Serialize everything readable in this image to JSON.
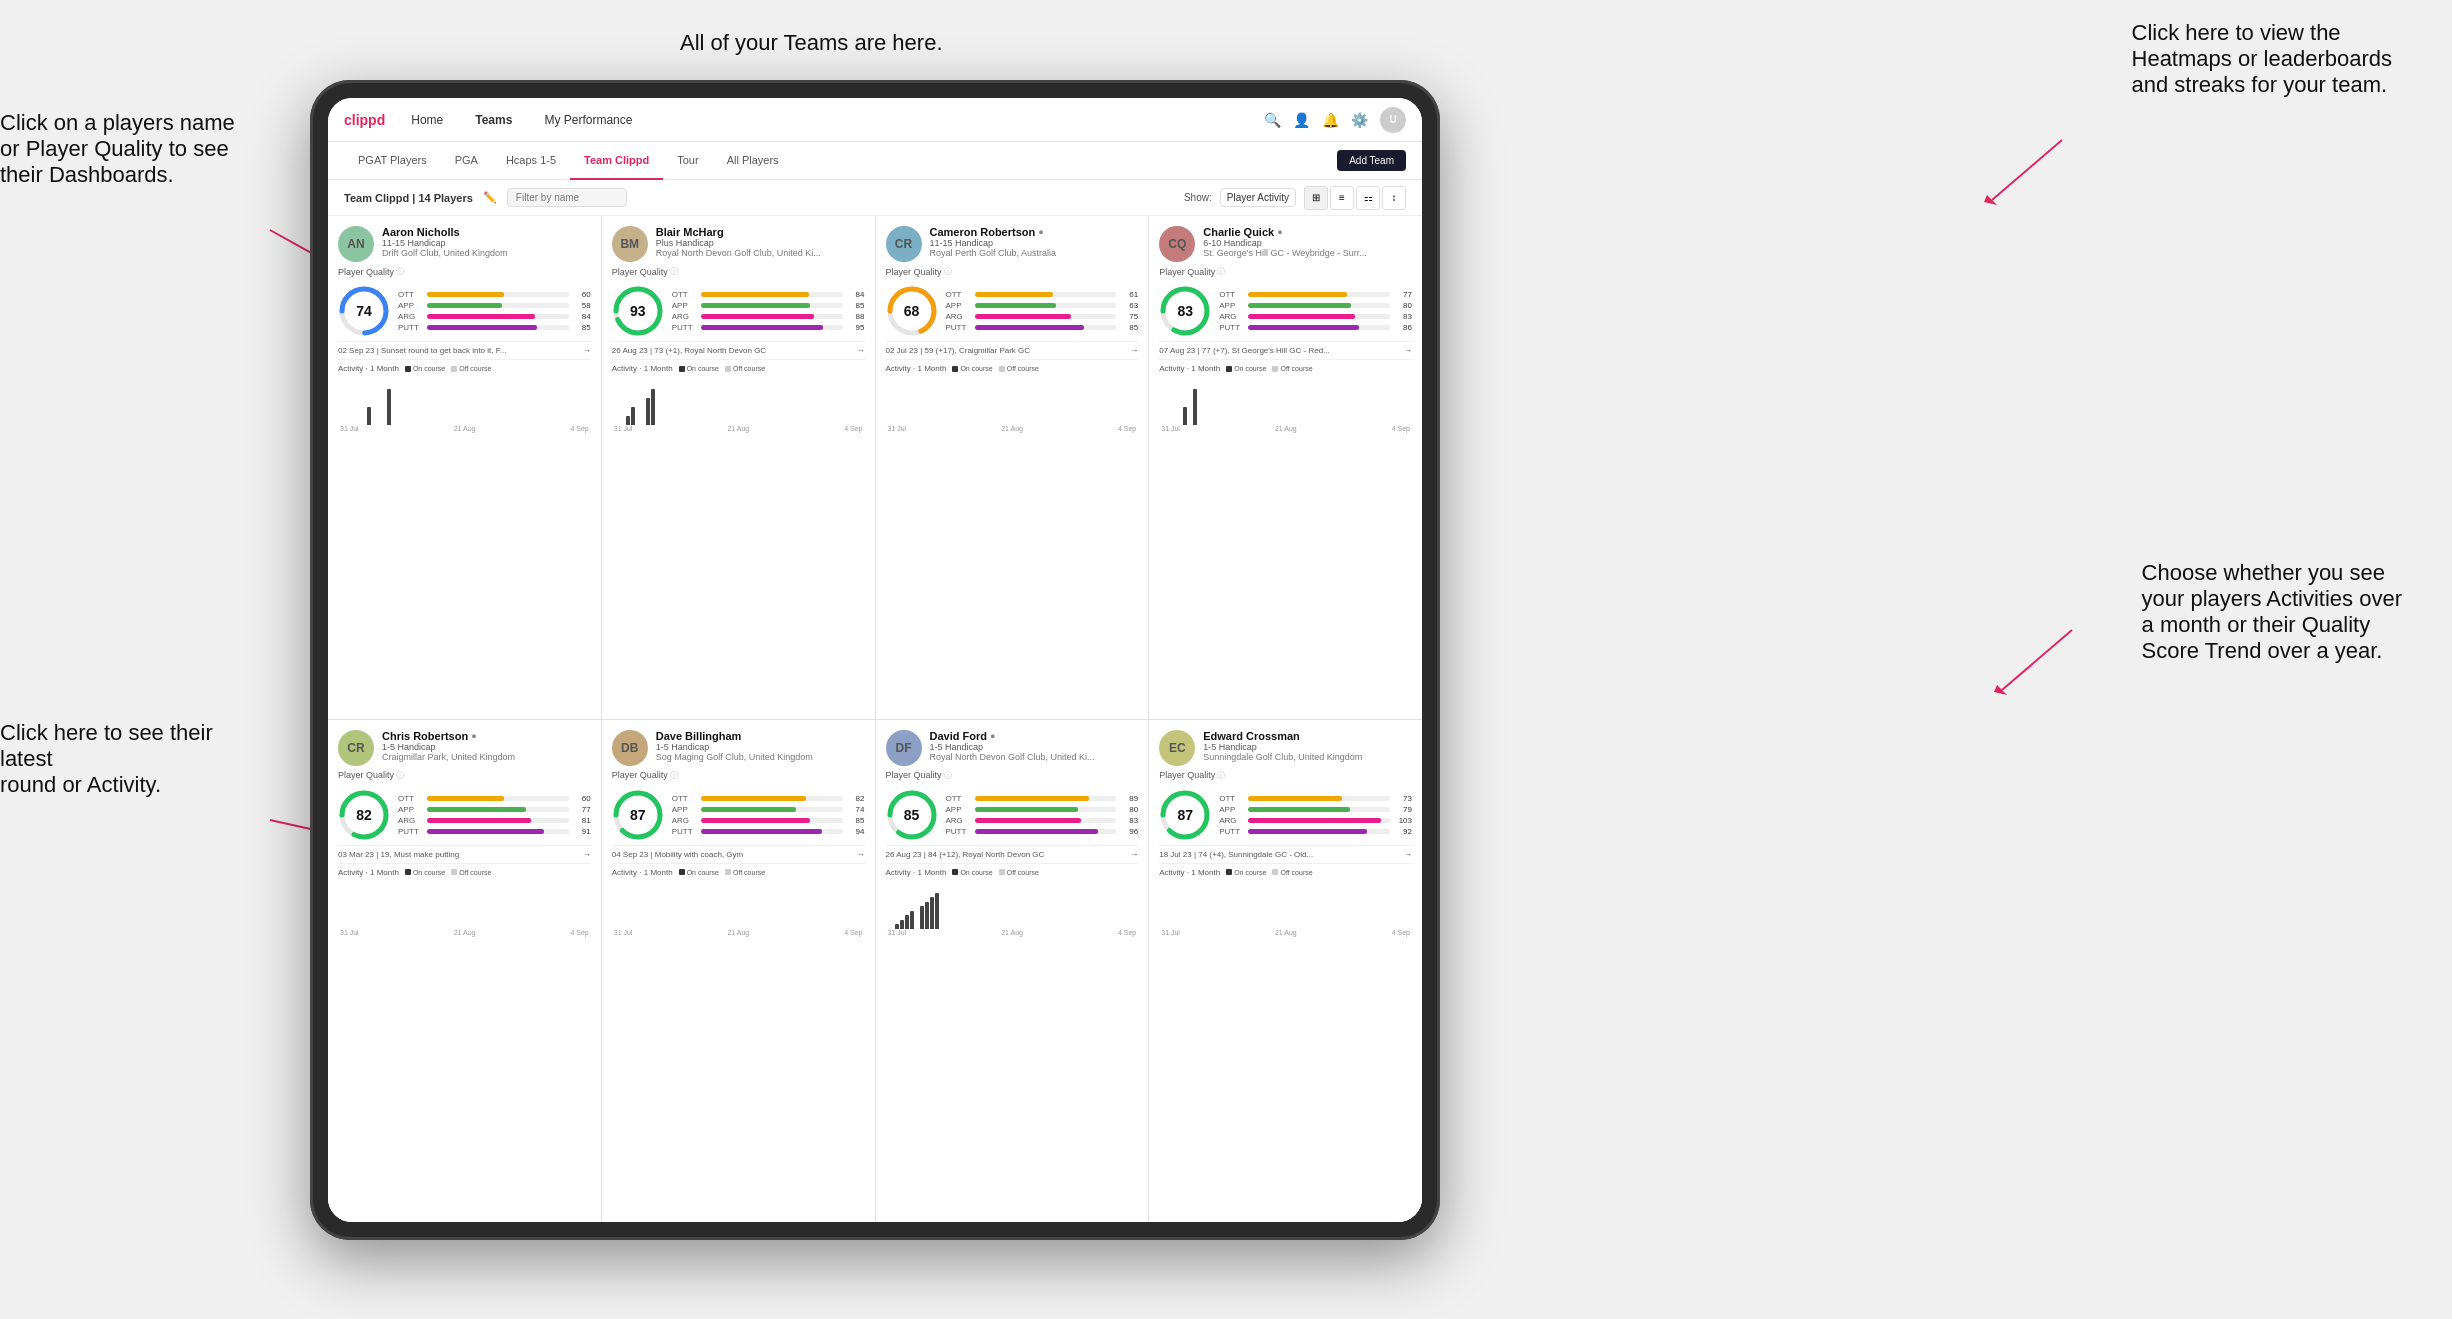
{
  "annotations": {
    "top_center": "All of your Teams are here.",
    "top_right_line1": "Click here to view the",
    "top_right_line2": "Heatmaps or leaderboards",
    "top_right_line3": "and streaks for your team.",
    "left_top_line1": "Click on a players name",
    "left_top_line2": "or Player Quality to see",
    "left_top_line3": "their Dashboards.",
    "left_bottom_line1": "Click here to see their latest",
    "left_bottom_line2": "round or Activity.",
    "bottom_right_line1": "Choose whether you see",
    "bottom_right_line2": "your players Activities over",
    "bottom_right_line3": "a month or their Quality",
    "bottom_right_line4": "Score Trend over a year."
  },
  "nav": {
    "logo": "clippd",
    "items": [
      "Home",
      "Teams",
      "My Performance"
    ],
    "active": "Teams"
  },
  "sub_nav": {
    "items": [
      "PGAT Players",
      "PGA",
      "Hcaps 1-5",
      "Team Clippd",
      "Tour",
      "All Players"
    ],
    "active": "Team Clippd",
    "add_button": "Add Team"
  },
  "filter_bar": {
    "label": "Team Clippd | 14 Players",
    "search_placeholder": "Filter by name",
    "show_label": "Show:",
    "show_value": "Player Activity"
  },
  "players": [
    {
      "id": 1,
      "name": "Aaron Nicholls",
      "handicap": "11-15 Handicap",
      "club": "Drift Golf Club, United Kingdom",
      "quality": 74,
      "quality_pct": 74,
      "ring_color": "#3b82f6",
      "ott": 60,
      "app": 58,
      "arg": 84,
      "putt": 85,
      "latest_round": "02 Sep 23 | Sunset round to get back into it, F...",
      "avatar_initials": "AN",
      "avatar_bg": "#8bc4a0",
      "activity_bars": [
        0,
        0,
        0,
        0,
        0,
        1,
        0,
        0,
        0,
        2,
        0,
        0
      ],
      "chart_labels": [
        "31 Jul",
        "21 Aug",
        "4 Sep"
      ]
    },
    {
      "id": 2,
      "name": "Blair McHarg",
      "handicap": "Plus Handicap",
      "club": "Royal North Devon Golf Club, United Ki...",
      "quality": 93,
      "quality_pct": 93,
      "ring_color": "#22c55e",
      "ott": 84,
      "app": 85,
      "arg": 88,
      "putt": 95,
      "latest_round": "26 Aug 23 | 73 (+1), Royal North Devon GC",
      "avatar_initials": "BM",
      "avatar_bg": "#c4b08b",
      "activity_bars": [
        0,
        0,
        1,
        2,
        0,
        0,
        3,
        4,
        0,
        0,
        0,
        0
      ],
      "chart_labels": [
        "31 Jul",
        "21 Aug",
        "4 Sep"
      ]
    },
    {
      "id": 3,
      "name": "Cameron Robertson",
      "handicap": "11-15 Handicap",
      "club": "Royal Perth Golf Club, Australia",
      "quality": 68,
      "quality_pct": 68,
      "ring_color": "#f59e0b",
      "ott": 61,
      "app": 63,
      "arg": 75,
      "putt": 85,
      "latest_round": "02 Jul 23 | 59 (+17), Craigmillar Park GC",
      "avatar_initials": "CR",
      "avatar_bg": "#7bafc4",
      "verified": true,
      "activity_bars": [
        0,
        0,
        0,
        0,
        0,
        0,
        0,
        0,
        0,
        0,
        0,
        0
      ],
      "chart_labels": [
        "31 Jul",
        "21 Aug",
        "4 Sep"
      ]
    },
    {
      "id": 4,
      "name": "Charlie Quick",
      "handicap": "6-10 Handicap",
      "club": "St. George's Hill GC - Weybridge - Surr...",
      "quality": 83,
      "quality_pct": 83,
      "ring_color": "#22c55e",
      "ott": 77,
      "app": 80,
      "arg": 83,
      "putt": 86,
      "latest_round": "07 Aug 23 | 77 (+7), St George's Hill GC - Red...",
      "avatar_initials": "CQ",
      "avatar_bg": "#c47b7b",
      "verified": true,
      "activity_bars": [
        0,
        0,
        0,
        0,
        1,
        0,
        2,
        0,
        0,
        0,
        0,
        0
      ],
      "chart_labels": [
        "31 Jul",
        "21 Aug",
        "4 Sep"
      ]
    },
    {
      "id": 5,
      "name": "Chris Robertson",
      "handicap": "1-5 Handicap",
      "club": "Craigmillar Park, United Kingdom",
      "quality": 82,
      "quality_pct": 82,
      "ring_color": "#22c55e",
      "ott": 60,
      "app": 77,
      "arg": 81,
      "putt": 91,
      "latest_round": "03 Mar 23 | 19, Must make putting",
      "avatar_initials": "CR",
      "avatar_bg": "#b0c47b",
      "verified": true,
      "activity_bars": [
        0,
        0,
        0,
        0,
        0,
        0,
        0,
        0,
        0,
        0,
        0,
        0
      ],
      "chart_labels": [
        "31 Jul",
        "21 Aug",
        "4 Sep"
      ]
    },
    {
      "id": 6,
      "name": "Dave Billingham",
      "handicap": "1-5 Handicap",
      "club": "Sog Maging Golf Club, United Kingdom",
      "quality": 87,
      "quality_pct": 87,
      "ring_color": "#22c55e",
      "ott": 82,
      "app": 74,
      "arg": 85,
      "putt": 94,
      "latest_round": "04 Sep 23 | Mobility with coach, Gym",
      "avatar_initials": "DB",
      "avatar_bg": "#c4a87b",
      "activity_bars": [
        0,
        0,
        0,
        0,
        0,
        0,
        0,
        0,
        0,
        0,
        0,
        0
      ],
      "chart_labels": [
        "31 Jul",
        "21 Aug",
        "4 Sep"
      ]
    },
    {
      "id": 7,
      "name": "David Ford",
      "handicap": "1-5 Handicap",
      "club": "Royal North Devon Golf Club, United Ki...",
      "quality": 85,
      "quality_pct": 85,
      "ring_color": "#22c55e",
      "ott": 89,
      "app": 80,
      "arg": 83,
      "putt": 96,
      "latest_round": "26 Aug 23 | 84 (+12), Royal North Devon GC",
      "avatar_initials": "DF",
      "avatar_bg": "#8ba0c4",
      "verified": true,
      "activity_bars": [
        0,
        1,
        2,
        3,
        4,
        0,
        5,
        6,
        7,
        8,
        0,
        0
      ],
      "chart_labels": [
        "31 Jul",
        "21 Aug",
        "4 Sep"
      ]
    },
    {
      "id": 8,
      "name": "Edward Crossman",
      "handicap": "1-5 Handicap",
      "club": "Sunningdale Golf Club, United Kingdom",
      "quality": 87,
      "quality_pct": 87,
      "ring_color": "#22c55e",
      "ott": 73,
      "app": 79,
      "arg": 103,
      "putt": 92,
      "latest_round": "18 Jul 23 | 74 (+4), Sunningdale GC - Old...",
      "avatar_initials": "EC",
      "avatar_bg": "#c4c47b",
      "activity_bars": [
        0,
        0,
        0,
        0,
        0,
        0,
        0,
        0,
        0,
        0,
        0,
        0
      ],
      "chart_labels": [
        "31 Jul",
        "21 Aug",
        "4 Sep"
      ]
    }
  ],
  "activity_label": "Activity · 1 Month",
  "oncourse_label": "On course",
  "offcourse_label": "Off course"
}
